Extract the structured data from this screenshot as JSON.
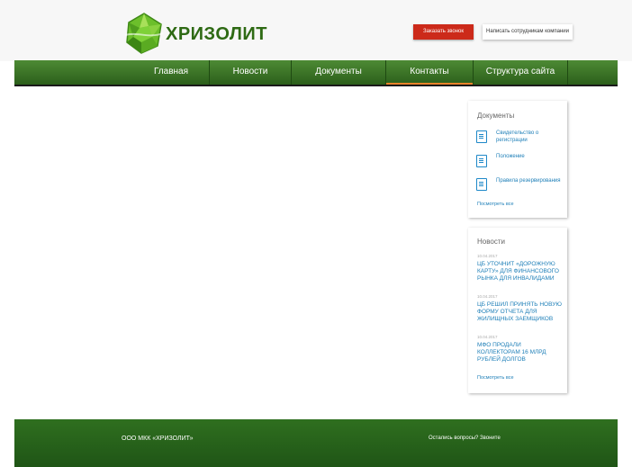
{
  "header": {
    "logo_text": "ХРИЗОЛИТ",
    "callback_label": "Заказать звонок",
    "feedback_label": "Написать сотрудникам компании"
  },
  "nav": {
    "items": [
      {
        "label": "Главная"
      },
      {
        "label": "Новости"
      },
      {
        "label": "Документы"
      },
      {
        "label": "Контакты",
        "active": true
      },
      {
        "label": "Структура сайта"
      }
    ]
  },
  "sidebar": {
    "documents": {
      "title": "Документы",
      "items": [
        {
          "label": "Свидетельство о регистрации"
        },
        {
          "label": "Положение"
        },
        {
          "label": "Правила резервирования"
        }
      ],
      "all_link": "Посмотреть все"
    },
    "news": {
      "title": "Новости",
      "items": [
        {
          "date": "10.04.2017",
          "headline": "ЦБ УТОЧНИТ «ДОРОЖНУЮ КАРТУ» ДЛЯ ФИНАНСОВОГО РЫНКА ДЛЯ ИНВАЛИДАМИ"
        },
        {
          "date": "10.04.2017",
          "headline": "ЦБ РЕШИЛ ПРИНЯТЬ НОВУЮ ФОРМУ ОТЧЕТА ДЛЯ ЖИЛИЩНЫХ ЗАЕМЩИКОВ"
        },
        {
          "date": "10.04.2017",
          "headline": "МФО ПРОДАЛИ КОЛЛЕКТОРАМ 16 МЛРД РУБЛЕЙ ДОЛГОВ"
        }
      ],
      "all_link": "Посмотреть все"
    }
  },
  "footer": {
    "company": "ООО МКК «ХРИЗОЛИТ»",
    "question_link": "Остались вопросы? Звоните"
  },
  "colors": {
    "nav_green": "#3f7a2a",
    "footer_green": "#2a6419",
    "accent_red": "#cc2a1a",
    "link_blue": "#1e7fb8",
    "active_orange": "#e8822a"
  }
}
